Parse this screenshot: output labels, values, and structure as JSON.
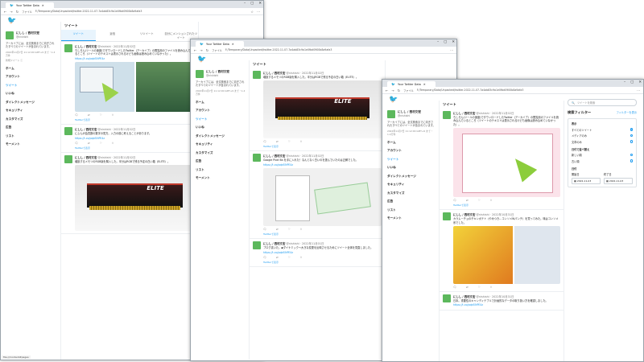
{
  "app": {
    "tab_title": "Your Twitter Data",
    "url_prefix": "ファイル",
    "url": "F:/Temporary/Data/Unpacked/twitter-2022-11-07-7a4ab83c9a1e0fbd0900b8a9afa3",
    "status_text": "file:///content#pages"
  },
  "profile": {
    "name": "にしし / 西村文宏",
    "handle": "@nishishi",
    "bio": "アーカイブには、全文検索までに向ぎされたすべてのツイートが含まれています。",
    "meta": "2022年11月7日 11:12:00 GMT+9 まで・1.4万件",
    "meta2": "新規ツイート ⓘ"
  },
  "nav": {
    "home": "ホーム",
    "account": "アカウント",
    "tweets": "ツイート",
    "likes": "いいね",
    "dm": "ダイレクトメッセージ",
    "security": "セキュリティ",
    "customize": "カスタマイズ",
    "ads": "広告",
    "lists": "リスト",
    "moments": "モーメント"
  },
  "timeline": {
    "header": "ツイート",
    "tabs": [
      "ツイート",
      "返信",
      "リツイート",
      "自分にメンションされたツイート"
    ],
    "tweets": [
      {
        "name": "にしし / 西村文宏",
        "handle": "@nishishi · 2022年11月02日",
        "text": "ちしろん(ツールの速度)でダウンロードしたTwitter（アーカイブ）の閲覧用のファイルを読み込んでいるところ（ツイートのテキストは表示されるけども画像は読み込めていなかった）。",
        "link": "https://t.co/pqbS9iPE4z",
        "more": "Twitterで表示"
      },
      {
        "name": "にしし / 西村文宏",
        "handle": "@nishishi · 2022年11月02日",
        "text": "にふんが会員数の数字の見方。入力の前に考えることがあります。",
        "link": "https://t.co/pqbS9iPE4z",
        "more": "Twitterで表示"
      },
      {
        "name": "にしし / 西村文宏",
        "handle": "@nishishi · 2022年11月02日",
        "text": "増設するメモリのRGB版を購入した。半分はRGBで残る予定の白い箱（ELITE）。",
        "link": "https://t.co/pqbS9iPE4z",
        "more": "Twitterで表示"
      },
      {
        "name": "にしし / 西村文宏",
        "handle": "@nishishi · 2022年11月02日",
        "text": "Google Pixel 6a を手に入れた！なんとなく白いのを選んでいたのは正解でした。",
        "link": "https://t.co/pqbS9iPE4z",
        "more": "Twitterで表示"
      },
      {
        "name": "にしし / 西村文宏",
        "handle": "@nishishi · 2022年11月01日",
        "text": "ブログ書いた。◆ダイナミック～大きな変更を反映させるためにツイート全体を見直しました。",
        "link": "https://t.co/pqbS9iPE4z",
        "more": "Twitterで表示"
      },
      {
        "name": "にしし / 西村文宏",
        "handle": "@nishishi · 2022年10月31日",
        "text": "カラムーチョのチキンポテト（やみつき…コンソメWパンチ）を買ってみた。味はコンソメ系でした。",
        "link": "https://t.co/pqbS9iPE4z",
        "more": "Twitterで表示"
      },
      {
        "name": "にしし / 西村文宏",
        "handle": "@nishishi · 2022年10月31日",
        "text": "日本。重要性のキャンディテブルで計画的なデータの取り扱い方を確認しました。",
        "link": "https://t.co/pqbS9iPE4z",
        "more": "Twitterで表示"
      }
    ],
    "media_label": "ELITE"
  },
  "right": {
    "search_placeholder": "ツイートを検索",
    "filter_title": "検索フィルター",
    "filter_reset": "フィルターを表示",
    "section_show": "表示",
    "opt_all": "すべてのツイート",
    "opt_media": "メディアのみ",
    "opt_text": "文章のみ",
    "section_order": "日付で並べ替え",
    "opt_new": "新しい順",
    "opt_old": "古い順",
    "section_date": "日付",
    "date_from_label": "開始日",
    "date_to_label": "終了日",
    "date_from": "2022-11-03",
    "date_to": "2022-11-03"
  }
}
